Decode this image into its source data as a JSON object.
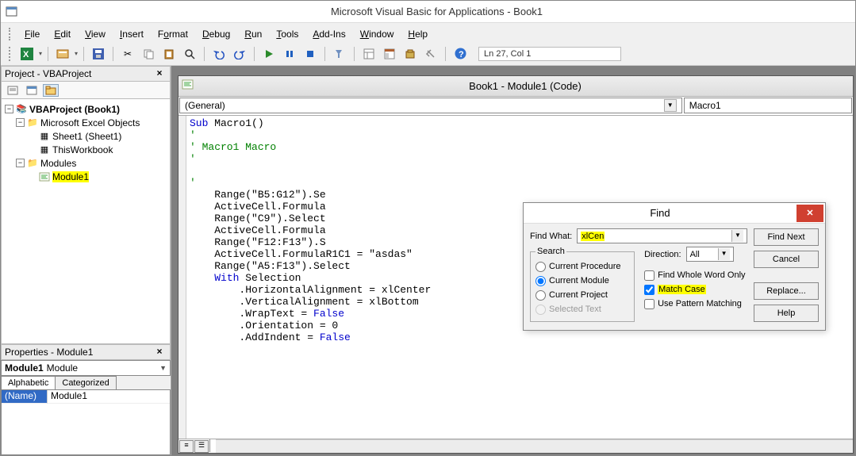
{
  "title": "Microsoft Visual Basic for Applications - Book1",
  "menu": [
    "File",
    "Edit",
    "View",
    "Insert",
    "Format",
    "Debug",
    "Run",
    "Tools",
    "Add-Ins",
    "Window",
    "Help"
  ],
  "status_bar": "Ln 27, Col 1",
  "project_panel": {
    "title": "Project - VBAProject",
    "root": "VBAProject (Book1)",
    "folder1": "Microsoft Excel Objects",
    "sheet1": "Sheet1 (Sheet1)",
    "thisworkbook": "ThisWorkbook",
    "folder2": "Modules",
    "module1": "Module1"
  },
  "properties_panel": {
    "title": "Properties - Module1",
    "combo_bold": "Module1",
    "combo_type": "Module",
    "tab_alpha": "Alphabetic",
    "tab_cat": "Categorized",
    "row_name_k": "(Name)",
    "row_name_v": "Module1"
  },
  "code_window": {
    "title": "Book1 - Module1 (Code)",
    "dd_left": "(General)",
    "dd_right": "Macro1",
    "code_lines": [
      {
        "t": "Sub Macro1()",
        "cls": "kw-sub"
      },
      {
        "t": "'",
        "cls": "cm"
      },
      {
        "t": "' Macro1 Macro",
        "cls": "cm"
      },
      {
        "t": "'",
        "cls": "cm"
      },
      {
        "t": "",
        "cls": ""
      },
      {
        "t": "'",
        "cls": "cm"
      },
      {
        "t": "    Range(\"B5:G12\").Se",
        "cls": ""
      },
      {
        "t": "    ActiveCell.Formula",
        "cls": ""
      },
      {
        "t": "    Range(\"C9\").Select",
        "cls": ""
      },
      {
        "t": "    ActiveCell.Formula",
        "cls": ""
      },
      {
        "t": "    Range(\"F12:F13\").S",
        "cls": ""
      },
      {
        "t": "    ActiveCell.FormulaR1C1 = \"asdas\"",
        "cls": ""
      },
      {
        "t": "    Range(\"A5:F13\").Select",
        "cls": ""
      },
      {
        "t": "    With Selection",
        "cls": "kw-with"
      },
      {
        "t": "        .HorizontalAlignment = xlCenter",
        "cls": ""
      },
      {
        "t": "        .VerticalAlignment = xlBottom",
        "cls": ""
      },
      {
        "t": "        .WrapText = False",
        "cls": "kw-false"
      },
      {
        "t": "        .Orientation = 0",
        "cls": ""
      },
      {
        "t": "        .AddIndent = False",
        "cls": "kw-false"
      }
    ]
  },
  "find_dialog": {
    "title": "Find",
    "find_what_label": "Find What:",
    "find_what_value": "xlCen",
    "search_legend": "Search",
    "opt_proc": "Current Procedure",
    "opt_module": "Current Module",
    "opt_project": "Current Project",
    "opt_selected": "Selected Text",
    "direction_label": "Direction:",
    "direction_value": "All",
    "chk_whole": "Find Whole Word Only",
    "chk_case": "Match Case",
    "chk_pattern": "Use Pattern Matching",
    "btn_next": "Find Next",
    "btn_cancel": "Cancel",
    "btn_replace": "Replace...",
    "btn_help": "Help",
    "search_scope_selected": "module",
    "match_case_checked": true
  }
}
